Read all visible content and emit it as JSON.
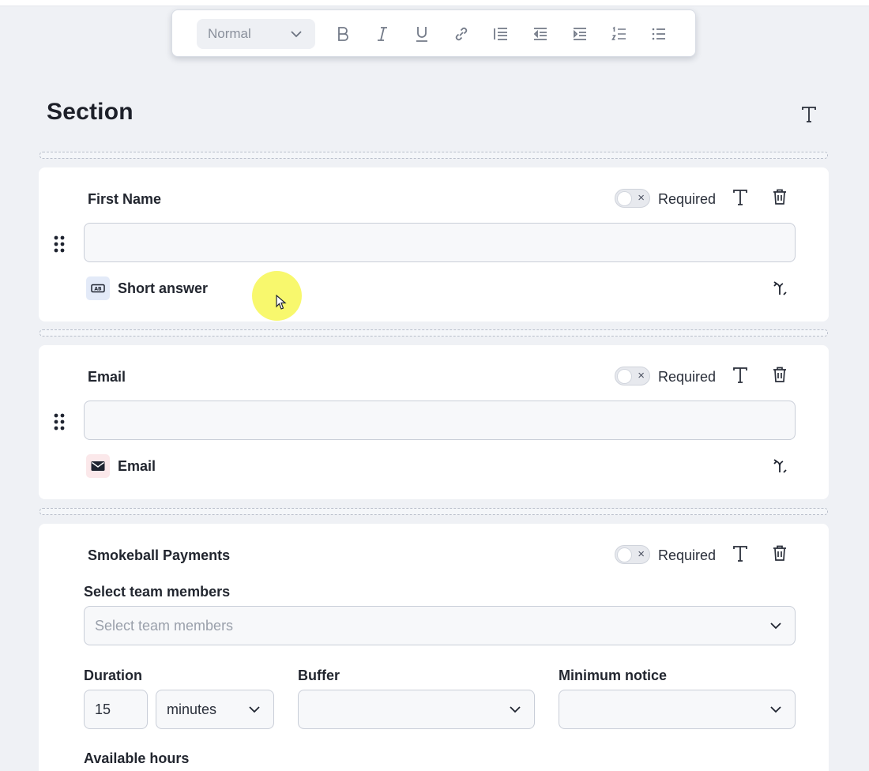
{
  "toolbar": {
    "block_style": "Normal",
    "buttons": [
      "bold",
      "italic",
      "underline",
      "link",
      "align-left",
      "outdent",
      "indent",
      "numbered-list",
      "bulleted-list"
    ]
  },
  "section": {
    "title": "Section"
  },
  "fields": [
    {
      "label": "First Name",
      "required_label": "Required",
      "required": false,
      "type_label": "Short answer",
      "type_icon": "short-answer-icon"
    },
    {
      "label": "Email",
      "required_label": "Required",
      "required": false,
      "type_label": "Email",
      "type_icon": "envelope-icon"
    }
  ],
  "payments": {
    "label": "Smokeball Payments",
    "required_label": "Required",
    "required": false,
    "team_members_label": "Select team members",
    "team_members_placeholder": "Select team members",
    "duration_label": "Duration",
    "duration_value": "15",
    "duration_unit": "minutes",
    "buffer_label": "Buffer",
    "buffer_value": "",
    "min_notice_label": "Minimum notice",
    "min_notice_value": "",
    "available_hours_label": "Available hours"
  },
  "colors": {
    "background": "#eff1f5",
    "card": "#ffffff",
    "short_answer_badge": "#e3eaf8",
    "email_badge": "#fbe8ea",
    "cursor_highlight": "#f5f53c"
  }
}
